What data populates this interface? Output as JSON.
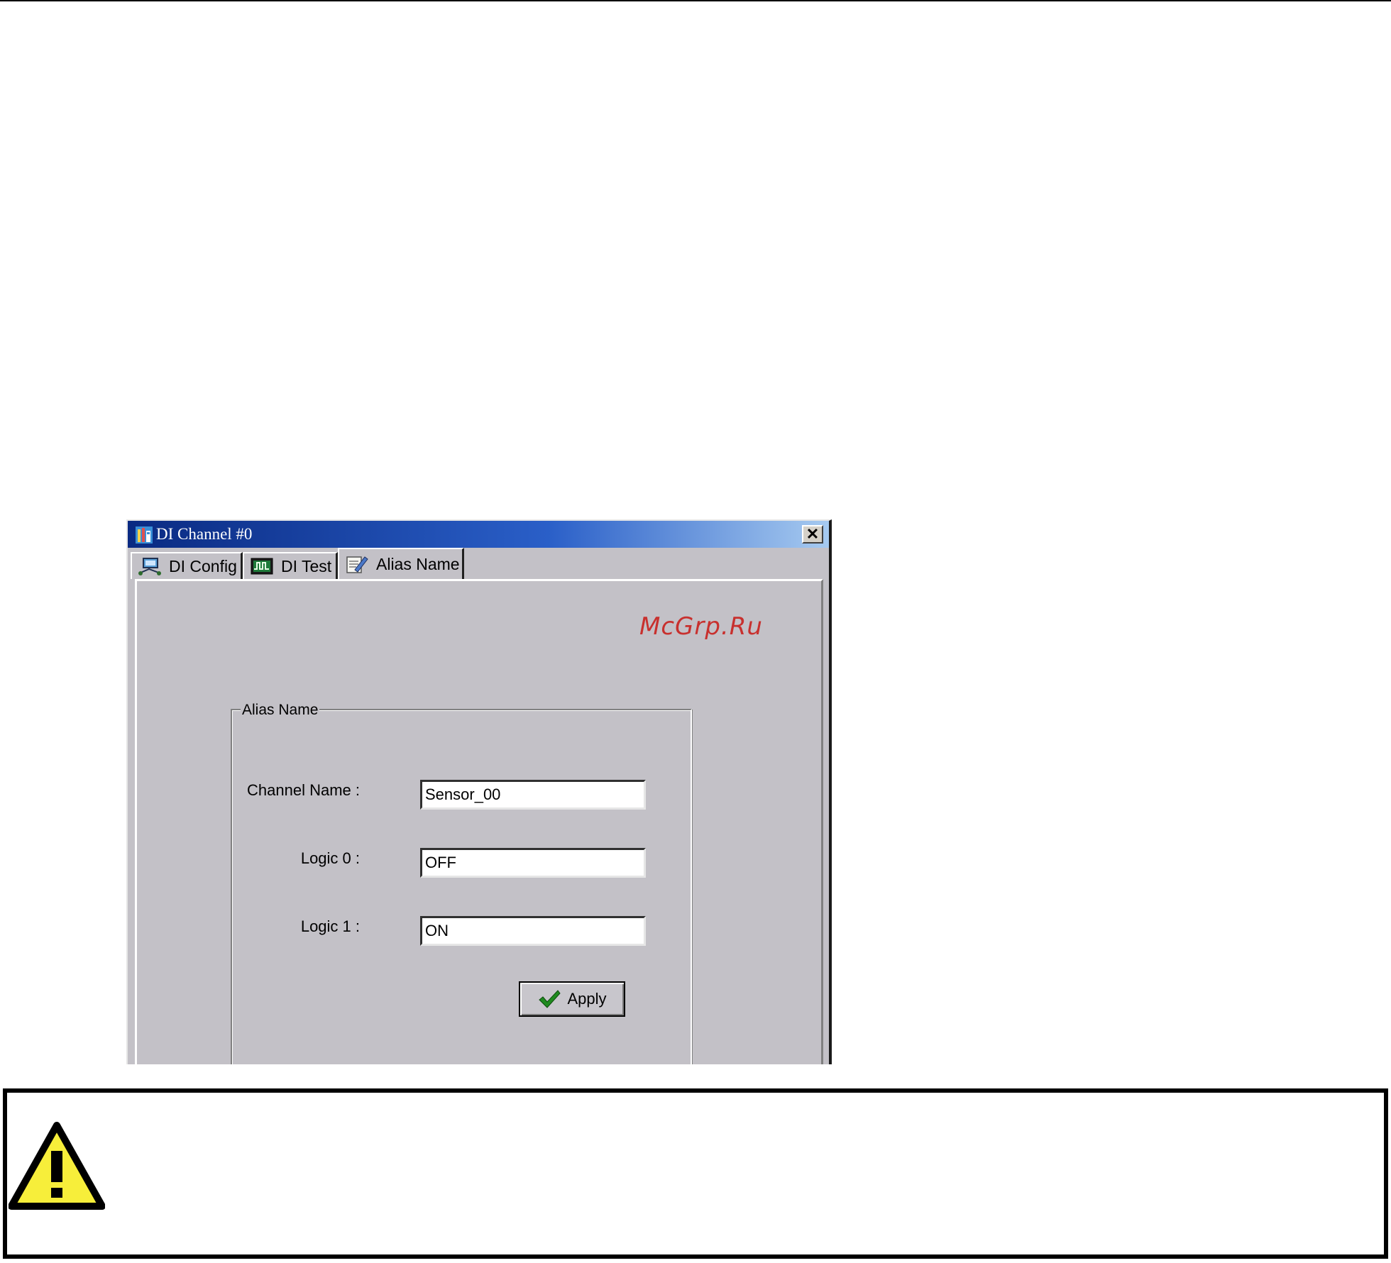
{
  "window": {
    "title": "DI Channel #0",
    "close_label": "✕"
  },
  "tabs": [
    {
      "label": "DI Config",
      "icon": "network-config-icon"
    },
    {
      "label": "DI Test",
      "icon": "waveform-test-icon"
    },
    {
      "label": "Alias Name",
      "icon": "notepad-edit-icon",
      "active": true
    }
  ],
  "watermark": "McGrp.Ru",
  "alias_group": {
    "legend": "Alias Name",
    "channel_name_label": "Channel Name :",
    "channel_name_value": "Sensor_00",
    "logic0_label": "Logic 0 :",
    "logic0_value": "OFF",
    "logic1_label": "Logic 1 :",
    "logic1_value": "ON",
    "apply_label": "Apply"
  },
  "notice": {
    "icon": "warning-triangle-icon",
    "colors": {
      "icon_fill": "#f7ee3a",
      "icon_stroke": "#000000"
    }
  },
  "colors": {
    "dialog_bg": "#c3c1c7",
    "titlebar_start": "#0a2a82",
    "titlebar_end": "#a6caf0",
    "watermark": "#c8302e",
    "apply_check": "#1f8a1f"
  }
}
